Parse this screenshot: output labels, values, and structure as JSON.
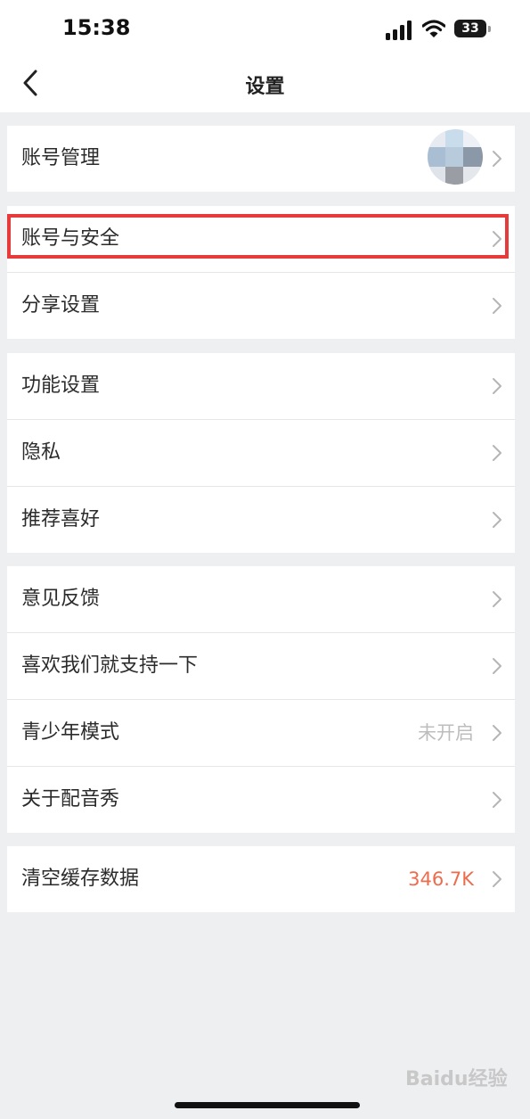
{
  "status": {
    "time": "15:38",
    "battery": "33"
  },
  "header": {
    "title": "设置"
  },
  "groups": [
    {
      "items": [
        {
          "label": "账号管理"
        }
      ]
    },
    {
      "items": [
        {
          "label": "账号与安全"
        },
        {
          "label": "分享设置"
        }
      ]
    },
    {
      "items": [
        {
          "label": "功能设置"
        },
        {
          "label": "隐私"
        },
        {
          "label": "推荐喜好"
        }
      ]
    },
    {
      "items": [
        {
          "label": "意见反馈"
        },
        {
          "label": "喜欢我们就支持一下"
        },
        {
          "label": "青少年模式",
          "value": "未开启"
        },
        {
          "label": "关于配音秀"
        }
      ]
    },
    {
      "items": [
        {
          "label": "清空缓存数据",
          "value": "346.7K"
        }
      ]
    }
  ],
  "watermark": "Baidu经验",
  "colors": {
    "highlight": "#e73a3a",
    "cache_value": "#ee6b4d",
    "muted_value": "#bdbdbd"
  }
}
